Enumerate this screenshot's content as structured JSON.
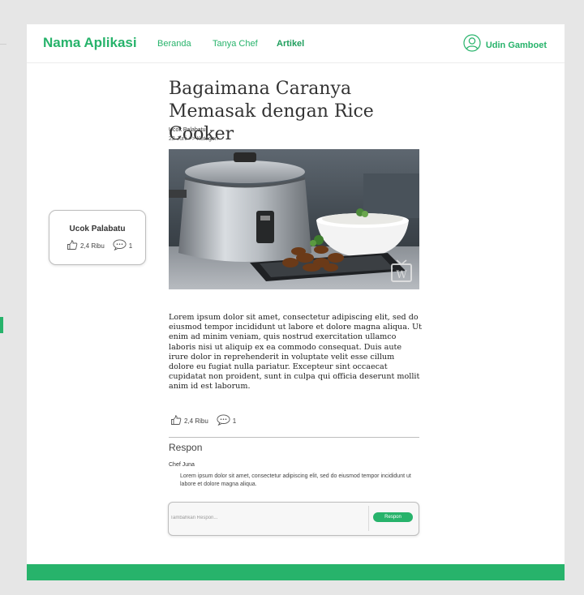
{
  "colors": {
    "accent": "#27b36b",
    "background": "#e6e6e6",
    "card": "#ffffff"
  },
  "header": {
    "brand": "Nama Aplikasi",
    "nav": [
      {
        "label": "Beranda"
      },
      {
        "label": "Tanya Chef"
      },
      {
        "label": "Artikel",
        "active": true
      }
    ],
    "user": {
      "name": "Udin Gamboet",
      "icon": "user-avatar-icon"
    }
  },
  "author_card": {
    "name": "Ucok Palabatu",
    "likes": "2,4 Ribu",
    "comments": "1",
    "like_icon": "thumbs-up-icon",
    "comment_icon": "speech-bubble-icon"
  },
  "article": {
    "title": "Bagaimana Caranya Memasak dengan Rice Cooker",
    "author": "Ucok Palabatu",
    "date_category": "22 Juni  >>  Kategori",
    "image_alt": "rice cooker with rice bowl and fried chicken",
    "watermark": "W",
    "body": "Lorem ipsum dolor sit amet, consectetur adipiscing elit, sed do eiusmod tempor incididunt ut labore et dolore magna aliqua. Ut enim ad minim veniam, quis nostrud exercitation ullamco laboris nisi ut aliquip ex ea commodo consequat. Duis aute irure dolor in reprehenderit in voluptate velit esse cillum dolore eu fugiat nulla pariatur. Excepteur sint occaecat cupidatat non proident, sunt in culpa qui officia deserunt mollit anim id est laborum.",
    "likes": "2,4 Ribu",
    "comments": "1"
  },
  "responses": {
    "heading": "Respon",
    "items": [
      {
        "author": "Chef Juna",
        "text": "Lorem ipsum dolor sit amet, consectetur adipiscing elit, sed do eiusmod tempor incididunt ut labore et dolore magna aliqua."
      }
    ],
    "input_placeholder": "Tambahkan Respon...",
    "button_label": "Respon"
  }
}
